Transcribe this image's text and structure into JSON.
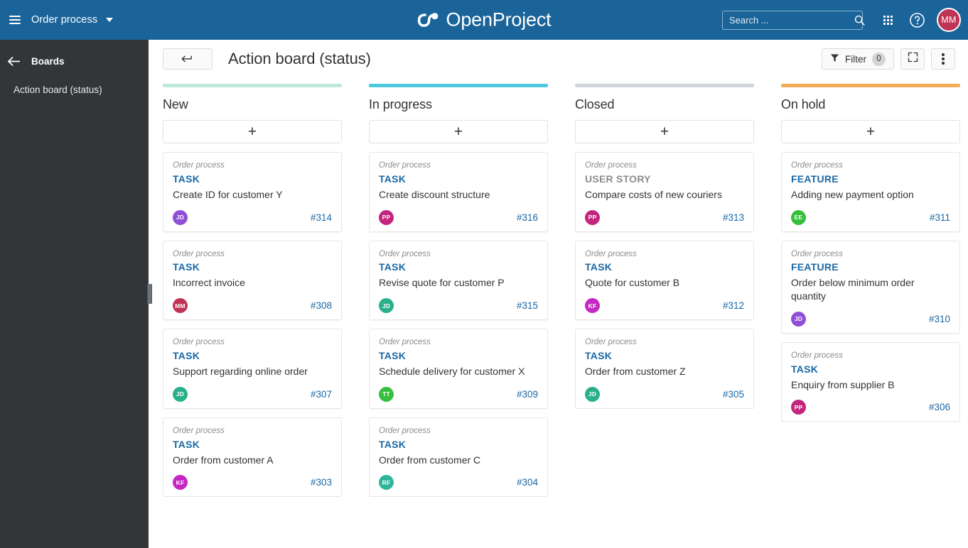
{
  "topbar": {
    "menu_icon": "hamburger-icon",
    "project_name": "Order process",
    "logo_text": "OpenProject",
    "search": {
      "placeholder": "Search ...",
      "value": "",
      "icon": "search-icon"
    },
    "grid_icon": "grid-modules-icon",
    "help_icon": "help-circle-icon",
    "avatar": {
      "initials": "MM",
      "color": "#bf3355"
    },
    "background": "#1a6499"
  },
  "sidebar": {
    "back_icon": "arrow-left-icon",
    "title": "Boards",
    "items": [
      {
        "label": "Action board (status)"
      }
    ],
    "background": "#333639"
  },
  "toolbar": {
    "back_button_icon": "return-arrow-icon",
    "board_title": "Action board (status)",
    "filter": {
      "label": "Filter",
      "count": "0",
      "icon": "funnel-icon"
    },
    "fullscreen_icon": "fullscreen-icon",
    "more_icon": "more-vertical-icon"
  },
  "board": {
    "add_label": "+",
    "columns": [
      {
        "name": "New",
        "bar_color": "#bdead8",
        "cards": [
          {
            "project": "Order process",
            "type": "TASK",
            "type_class": "type-task",
            "subject": "Create ID for customer Y",
            "assignee": "JD",
            "avatar_color": "#8f4fd6",
            "id": "#314"
          },
          {
            "project": "Order process",
            "type": "TASK",
            "type_class": "type-task",
            "subject": "Incorrect invoice",
            "assignee": "MM",
            "avatar_color": "#bf3355",
            "id": "#308"
          },
          {
            "project": "Order process",
            "type": "TASK",
            "type_class": "type-task",
            "subject": "Support regarding online order",
            "assignee": "JD",
            "avatar_color": "#28b08a",
            "id": "#307"
          },
          {
            "project": "Order process",
            "type": "TASK",
            "type_class": "type-task",
            "subject": "Order from customer A",
            "assignee": "KF",
            "avatar_color": "#c428c4",
            "id": "#303"
          }
        ]
      },
      {
        "name": "In progress",
        "bar_color": "#4cc9e0",
        "cards": [
          {
            "project": "Order process",
            "type": "TASK",
            "type_class": "type-task",
            "subject": "Create discount structure",
            "assignee": "PP",
            "avatar_color": "#c4247e",
            "id": "#316"
          },
          {
            "project": "Order process",
            "type": "TASK",
            "type_class": "type-task",
            "subject": "Revise quote for customer P",
            "assignee": "JD",
            "avatar_color": "#28b08a",
            "id": "#315"
          },
          {
            "project": "Order process",
            "type": "TASK",
            "type_class": "type-task",
            "subject": "Schedule delivery for customer X",
            "assignee": "TT",
            "avatar_color": "#35bf3c",
            "id": "#309"
          },
          {
            "project": "Order process",
            "type": "TASK",
            "type_class": "type-task",
            "subject": "Order from customer C",
            "assignee": "RF",
            "avatar_color": "#30b59a",
            "id": "#304"
          }
        ]
      },
      {
        "name": "Closed",
        "bar_color": "#d2d4dd",
        "cards": [
          {
            "project": "Order process",
            "type": "USER STORY",
            "type_class": "type-userstory",
            "subject": "Compare costs of new couriers",
            "assignee": "PP",
            "avatar_color": "#c4247e",
            "id": "#313"
          },
          {
            "project": "Order process",
            "type": "TASK",
            "type_class": "type-task",
            "subject": "Quote for customer B",
            "assignee": "KF",
            "avatar_color": "#c428c4",
            "id": "#312"
          },
          {
            "project": "Order process",
            "type": "TASK",
            "type_class": "type-task",
            "subject": "Order from customer Z",
            "assignee": "JD",
            "avatar_color": "#28b08a",
            "id": "#305"
          }
        ]
      },
      {
        "name": "On hold",
        "bar_color": "#f5ab53",
        "cards": [
          {
            "project": "Order process",
            "type": "FEATURE",
            "type_class": "type-feature",
            "subject": "Adding new payment option",
            "assignee": "EE",
            "avatar_color": "#35bf3c",
            "id": "#311"
          },
          {
            "project": "Order process",
            "type": "FEATURE",
            "type_class": "type-feature",
            "subject": "Order below minimum order quantity",
            "assignee": "JD",
            "avatar_color": "#8f4fd6",
            "id": "#310"
          },
          {
            "project": "Order process",
            "type": "TASK",
            "type_class": "type-task",
            "subject": "Enquiry from supplier B",
            "assignee": "PP",
            "avatar_color": "#c4247e",
            "id": "#306"
          }
        ]
      }
    ]
  }
}
